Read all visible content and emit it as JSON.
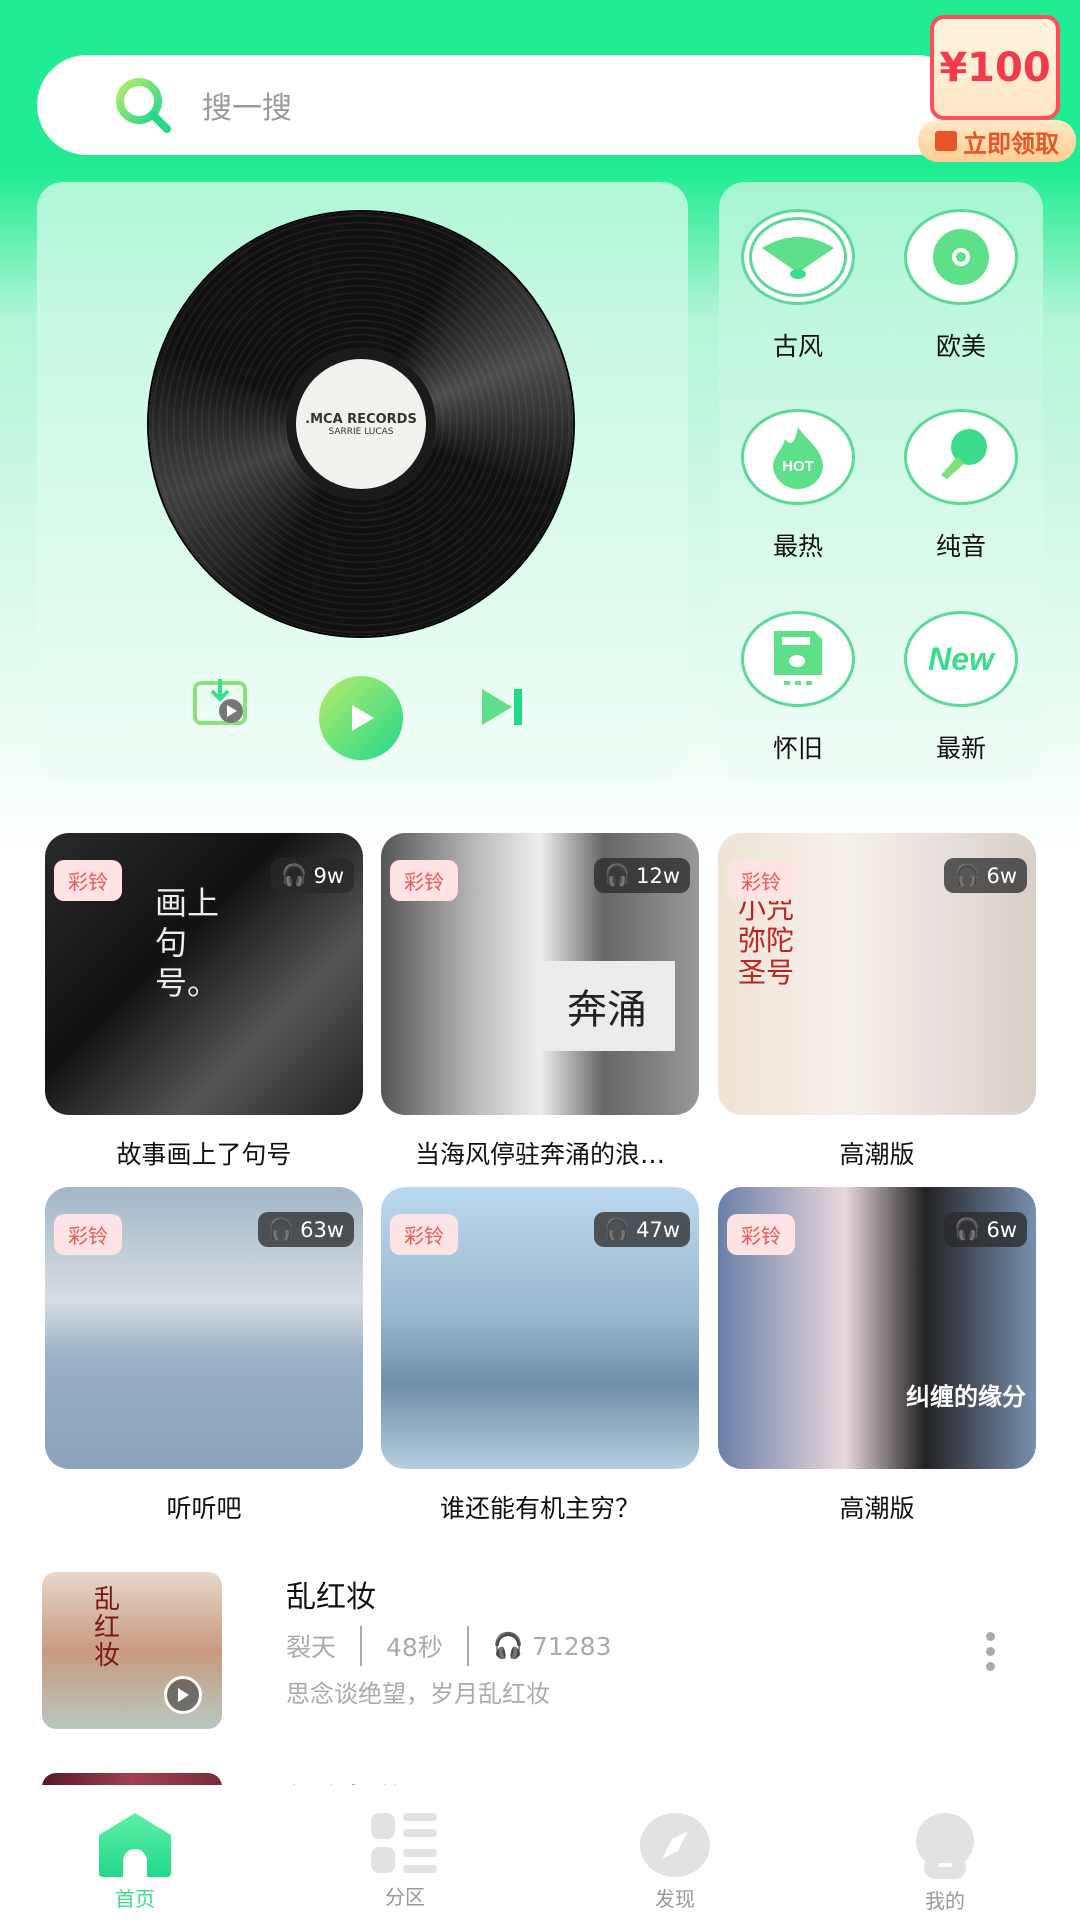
{
  "search": {
    "placeholder": "搜一搜",
    "icon": "search-icon"
  },
  "promo": {
    "amount": "¥100",
    "cta": "立即领取"
  },
  "player": {
    "record_label": ".MCA RECORDS",
    "record_artist": "SARRIE LUCAS",
    "controls": [
      "download-icon",
      "play-icon",
      "next-icon"
    ]
  },
  "categories": [
    {
      "label": "古风",
      "icon": "fan-icon"
    },
    {
      "label": "欧美",
      "icon": "cd-icon"
    },
    {
      "label": "最热",
      "icon": "hot-flame-icon"
    },
    {
      "label": "纯音",
      "icon": "microphone-icon"
    },
    {
      "label": "怀旧",
      "icon": "floppy-disk-icon"
    },
    {
      "label": "最新",
      "icon": "new-icon"
    }
  ],
  "tiles": [
    {
      "badge": "彩铃",
      "plays": "9w",
      "title": "故事画上了句号",
      "cover_text": "画上句号。"
    },
    {
      "badge": "彩铃",
      "plays": "12w",
      "title": "当海风停驻奔涌的浪…",
      "cover_text": "奔涌"
    },
    {
      "badge": "彩铃",
      "plays": "6w",
      "title": "高潮版",
      "cover_text": "小咒弥陀圣号"
    },
    {
      "badge": "彩铃",
      "plays": "63w",
      "title": "听听吧"
    },
    {
      "badge": "彩铃",
      "plays": "47w",
      "title": "谁还能有机主穷？"
    },
    {
      "badge": "彩铃",
      "plays": "6w",
      "title": "高潮版",
      "cover_text": "纠缠的缘分"
    }
  ],
  "songs": [
    {
      "title": "乱红妆",
      "artist": "裂天",
      "duration": "48秒",
      "plays": "71283",
      "desc": "思念谈绝望，岁月乱红妆",
      "cover_text": "乱红妆"
    },
    {
      "title": "红尘相伴"
    }
  ],
  "nav": [
    {
      "label": "首页",
      "icon": "home-icon",
      "active": true
    },
    {
      "label": "分区",
      "icon": "category-list-icon"
    },
    {
      "label": "发现",
      "icon": "compass-icon"
    },
    {
      "label": "我的",
      "icon": "profile-icon"
    }
  ],
  "colors": {
    "accent": "#1fec93",
    "active_nav": "#3ddc8c",
    "inactive_nav": "#999999",
    "badge_text": "#e8595b"
  }
}
